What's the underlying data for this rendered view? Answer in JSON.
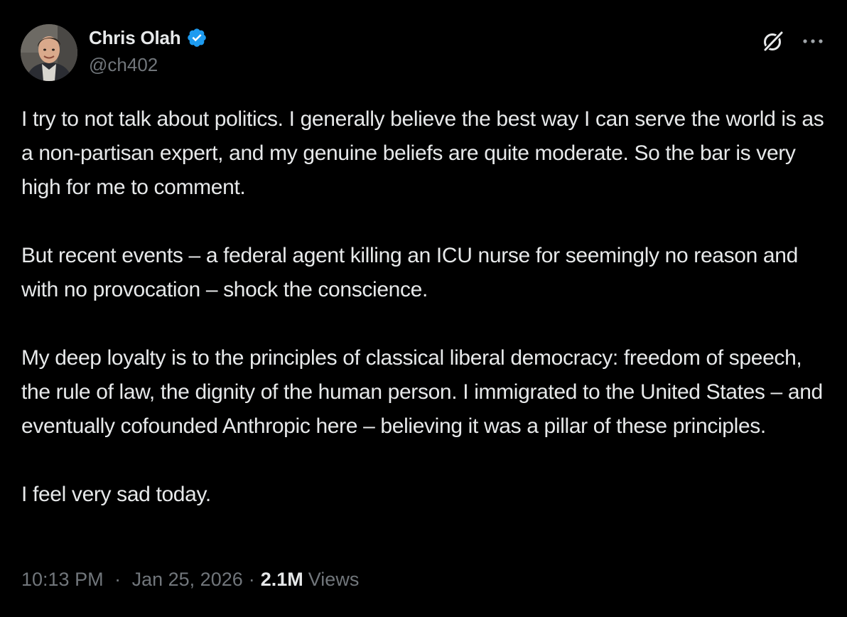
{
  "author": {
    "display_name": "Chris Olah",
    "handle": "@ch402",
    "verified": true,
    "verified_color": "#1d9bf0",
    "avatar_icon": "profile-photo"
  },
  "actions": {
    "grok_icon": "grok-icon",
    "more_icon": "more-horizontal-icon"
  },
  "tweet": {
    "paragraphs": [
      "I try to not talk about politics. I generally believe the best way I can serve the world is as a non-partisan expert, and my genuine beliefs are quite moderate. So the bar is very high for me to comment.",
      "But recent events – a federal agent killing an ICU nurse for seemingly no reason and with no provocation – shock the conscience.",
      "My deep loyalty is to the principles of classical liberal democracy: freedom of speech, the rule of law, the dignity of the human person. I immigrated to the United States – and eventually cofounded Anthropic here – believing it was a pillar of these principles.",
      "I feel very sad today."
    ]
  },
  "meta": {
    "time": "10:13 PM",
    "date": "Jan 25, 2026",
    "separator": "·",
    "views_count": "2.1M",
    "views_label": "Views"
  },
  "colors": {
    "background": "#000000",
    "text_primary": "#e7e9ea",
    "text_secondary": "#71767b",
    "accent": "#1d9bf0"
  }
}
